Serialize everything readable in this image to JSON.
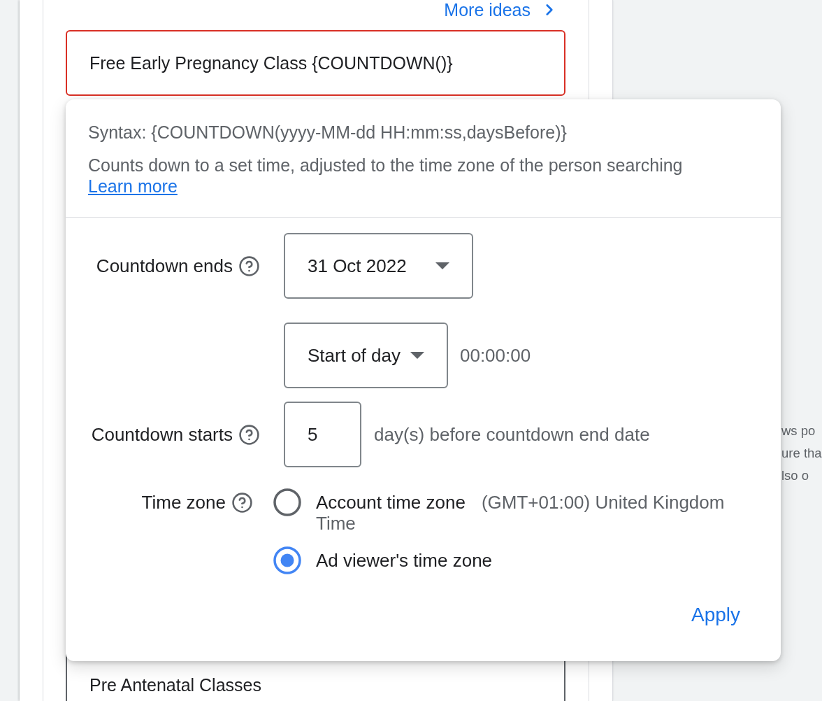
{
  "more_ideas_link": {
    "label": "More ideas"
  },
  "headline_field": {
    "value": "Free Early Pregnancy Class {COUNTDOWN()}",
    "error": true
  },
  "countdown_popup": {
    "syntax": "Syntax: {COUNTDOWN(yyyy-MM-dd HH:mm:ss,daysBefore)}",
    "description": "Counts down to a set time, adjusted to the time zone of the person searching",
    "learn_more_link": "Learn more",
    "countdown_ends": {
      "label": "Countdown ends",
      "date": "31 Oct 2022",
      "time_of_day": "Start of day",
      "time": "00:00:00"
    },
    "countdown_starts": {
      "label": "Countdown starts",
      "value": "5",
      "suffix": "day(s) before countdown end date"
    },
    "time_zone": {
      "label": "Time zone",
      "options": [
        {
          "label": "Account time zone",
          "detail": "(GMT+01:00) United Kingdom Time",
          "selected": false
        },
        {
          "label": "Ad viewer's time zone",
          "selected": true
        }
      ]
    },
    "apply_button": "Apply"
  },
  "next_field": {
    "value": "Pre Antenatal Classes"
  },
  "background_text": [
    "ws po",
    "ure tha",
    "lso o"
  ]
}
